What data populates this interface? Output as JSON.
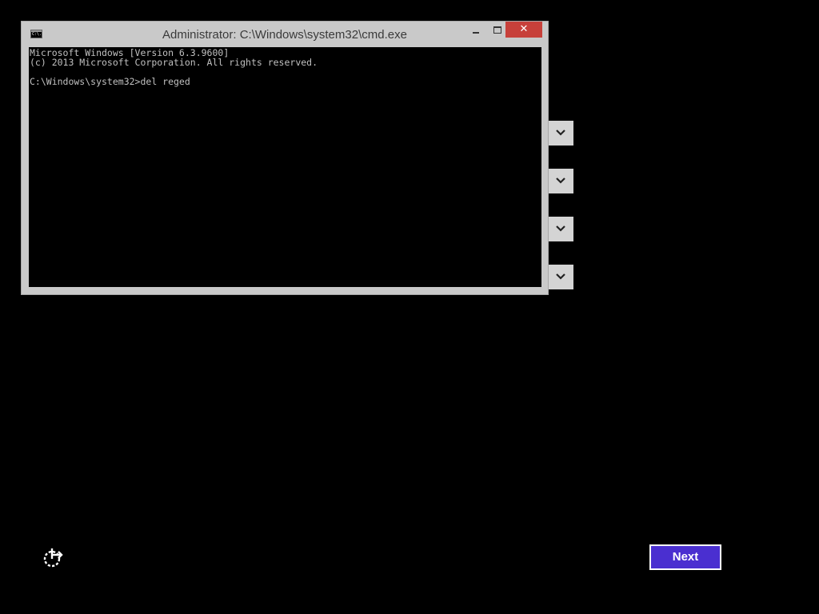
{
  "window": {
    "title": "Administrator: C:\\Windows\\system32\\cmd.exe",
    "icon": "cmd-icon",
    "icon_label": "C:\\.",
    "close_symbol": "✕",
    "close_color": "#c7403a"
  },
  "console": {
    "lines": [
      "Microsoft Windows [Version 6.3.9600]",
      "(c) 2013 Microsoft Corporation. All rights reserved.",
      "",
      "C:\\Windows\\system32>del reged"
    ]
  },
  "dropdowns": [
    {
      "icon": "chevron-down-icon"
    },
    {
      "icon": "chevron-down-icon"
    },
    {
      "icon": "chevron-down-icon"
    },
    {
      "icon": "chevron-down-icon"
    }
  ],
  "footer": {
    "ease_of_access_icon": "ease-of-access-icon",
    "next_label": "Next",
    "next_color": "#4a2fd0"
  }
}
